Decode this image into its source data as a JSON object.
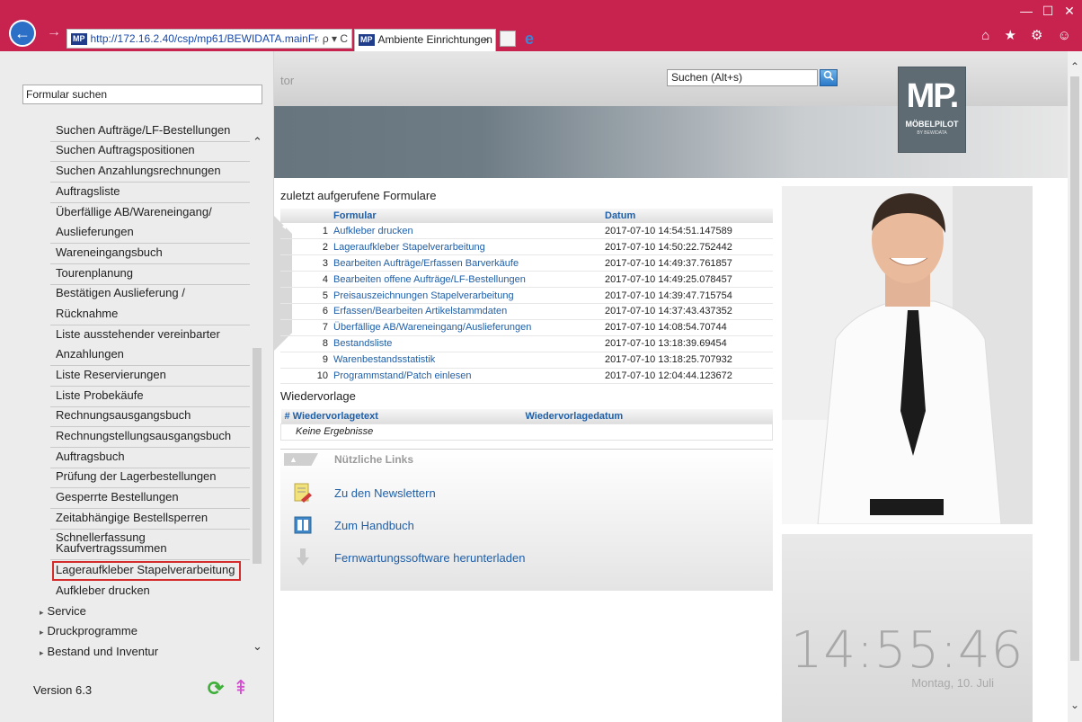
{
  "browser": {
    "url": "http://172.16.2.40/csp/mp61/BEWIDATA.mainFra",
    "address_controls": "ρ ▾ C",
    "tab_title": "Ambiente Einrichtungen",
    "tab_close": "×",
    "favicon": "MP",
    "back": "←",
    "forward": "→",
    "minimize": "—",
    "maximize": "☐",
    "close": "✕",
    "toolbar_icons": "⌂ ★ ⚙ ☺"
  },
  "app": {
    "title_stub": "tor",
    "search_placeholder": "Suchen (Alt+s)",
    "search_button": "🔍",
    "logo": {
      "mark": "MP.",
      "name": "MÖBELPILOT",
      "sub": "BY BEWIDATA"
    }
  },
  "leftpanel": {
    "search_value": "Formular suchen",
    "items": [
      "Suchen Aufträge/LF-Bestellungen",
      "Suchen Auftragspositionen",
      "Suchen Anzahlungsrechnungen",
      "Auftragsliste",
      "Überfällige AB/Wareneingang/",
      "Auslieferungen",
      "Wareneingangsbuch",
      "Tourenplanung",
      "Bestätigen Auslieferung /",
      "Rücknahme",
      "Liste ausstehender vereinbarter",
      "Anzahlungen",
      "Liste Reservierungen",
      "Liste Probekäufe",
      "Rechnungsausgangsbuch",
      "Rechnungstellungsausgangsbuch",
      "Auftragsbuch",
      "Prüfung der Lagerbestellungen",
      "Gesperrte Bestellungen",
      "Zeitabhängige Bestellsperren",
      "Schnellerfassung",
      "Kaufvertragssummen",
      "Lageraufkleber Stapelverarbeitung",
      "Aufkleber drucken"
    ],
    "groups": [
      "Service",
      "Druckprogramme",
      "Bestand und Inventur"
    ],
    "version": "Version 6.3"
  },
  "recent": {
    "heading": "zuletzt aufgerufene Formulare",
    "col_form": "Formular",
    "col_date": "Datum",
    "rows": [
      {
        "n": "1",
        "form": "Aufkleber drucken",
        "date": "2017-07-10 14:54:51.147589"
      },
      {
        "n": "2",
        "form": "Lageraufkleber Stapelverarbeitung",
        "date": "2017-07-10 14:50:22.752442"
      },
      {
        "n": "3",
        "form": "Bearbeiten Aufträge/Erfassen Barverkäufe",
        "date": "2017-07-10 14:49:37.761857"
      },
      {
        "n": "4",
        "form": "Bearbeiten offene Aufträge/LF-Bestellungen",
        "date": "2017-07-10 14:49:25.078457"
      },
      {
        "n": "5",
        "form": "Preisauszeichnungen Stapelverarbeitung",
        "date": "2017-07-10 14:39:47.715754"
      },
      {
        "n": "6",
        "form": "Erfassen/Bearbeiten Artikelstammdaten",
        "date": "2017-07-10 14:37:43.437352"
      },
      {
        "n": "7",
        "form": "Überfällige AB/Wareneingang/Auslieferungen",
        "date": "2017-07-10 14:08:54.70744"
      },
      {
        "n": "8",
        "form": "Bestandsliste",
        "date": "2017-07-10 13:18:39.69454"
      },
      {
        "n": "9",
        "form": "Warenbestandsstatistik",
        "date": "2017-07-10 13:18:25.707932"
      },
      {
        "n": "10",
        "form": "Programmstand/Patch einlesen",
        "date": "2017-07-10 12:04:44.123672"
      }
    ]
  },
  "wiedervorlage": {
    "heading": "Wiedervorlage",
    "col_text": "# Wiedervorlagetext",
    "col_date": "Wiedervorlagedatum",
    "empty": "Keine Ergebnisse"
  },
  "links": {
    "title": "Nützliche Links",
    "toggle": "▲",
    "items": [
      "Zu den Newslettern",
      "Zum Handbuch",
      "Fernwartungssoftware herunterladen"
    ]
  },
  "clock": {
    "time": "14:55:46",
    "date": "Montag, 10. Juli"
  },
  "colors": {
    "titlebar": "#c8234f",
    "link": "#1f5fa8",
    "highlight": "#d42c2c"
  }
}
